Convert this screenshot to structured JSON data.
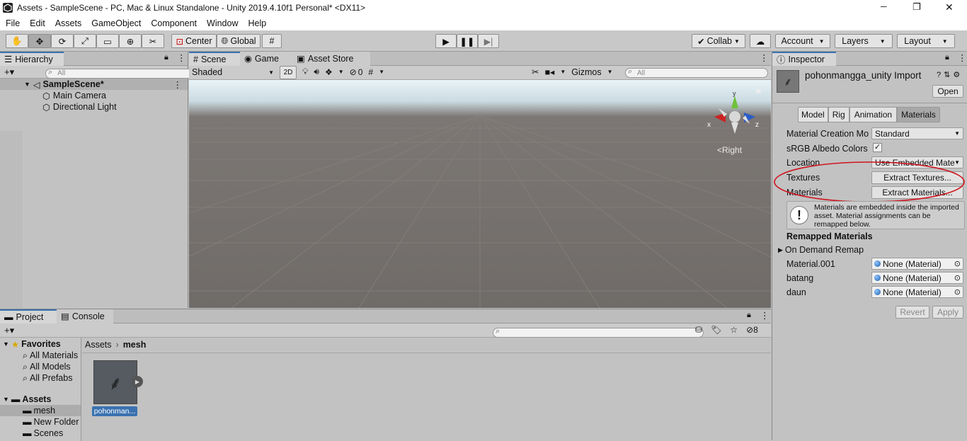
{
  "window": {
    "title": "Assets - SampleScene - PC, Mac & Linux Standalone - Unity 2019.4.10f1 Personal* <DX11>",
    "minimize": "─",
    "restore": "❐",
    "close": "✕"
  },
  "menu": [
    "File",
    "Edit",
    "Assets",
    "GameObject",
    "Component",
    "Window",
    "Help"
  ],
  "toolbar": {
    "pivot": "Center",
    "space": "Global",
    "collab": "Collab",
    "account": "Account",
    "layers": "Layers",
    "layout": "Layout"
  },
  "hierarchy": {
    "tab": "Hierarchy",
    "search_placeholder": "All",
    "scene": "SampleScene*",
    "items": [
      "Main Camera",
      "Directional Light"
    ]
  },
  "scene_view": {
    "tabs": [
      "Scene",
      "Game",
      "Asset Store"
    ],
    "shading": "Shaded",
    "mode_2d": "2D",
    "hidden_count": "0",
    "gizmos": "Gizmos",
    "search_placeholder": "All",
    "axis_x": "x",
    "axis_y": "y",
    "axis_z": "z",
    "view_label": "Right"
  },
  "project": {
    "tabs": [
      "Project",
      "Console"
    ],
    "favorites_label": "Favorites",
    "favorites": [
      "All Materials",
      "All Models",
      "All Prefabs"
    ],
    "assets_label": "Assets",
    "folders": [
      "mesh",
      "New Folder",
      "Scenes"
    ],
    "breadcrumb": [
      "Assets",
      "mesh"
    ],
    "hidden_count": "8",
    "asset_name": "pohonman..."
  },
  "inspector": {
    "tab": "Inspector",
    "title": "pohonmangga_unity Import",
    "open_button": "Open",
    "tabs": [
      "Model",
      "Rig",
      "Animation",
      "Materials"
    ],
    "active_tab": "Materials",
    "material_creation_label": "Material Creation Mo",
    "material_creation_value": "Standard",
    "srgb_label": "sRGB Albedo Colors",
    "srgb_checked": true,
    "location_label": "Location",
    "location_value": "Use Embedded Mate",
    "textures_label": "Textures",
    "extract_textures": "Extract Textures...",
    "materials_label": "Materials",
    "extract_materials": "Extract Materials...",
    "info_text": "Materials are embedded inside the imported asset. Material assignments can be remapped below.",
    "remapped_header": "Remapped Materials",
    "on_demand": "On Demand Remap",
    "remaps": [
      {
        "name": "Material.001",
        "value": "None (Material)"
      },
      {
        "name": "batang",
        "value": "None (Material)"
      },
      {
        "name": "daun",
        "value": "None (Material)"
      }
    ],
    "revert": "Revert",
    "apply": "Apply",
    "highlight_color": "#d0141e"
  }
}
